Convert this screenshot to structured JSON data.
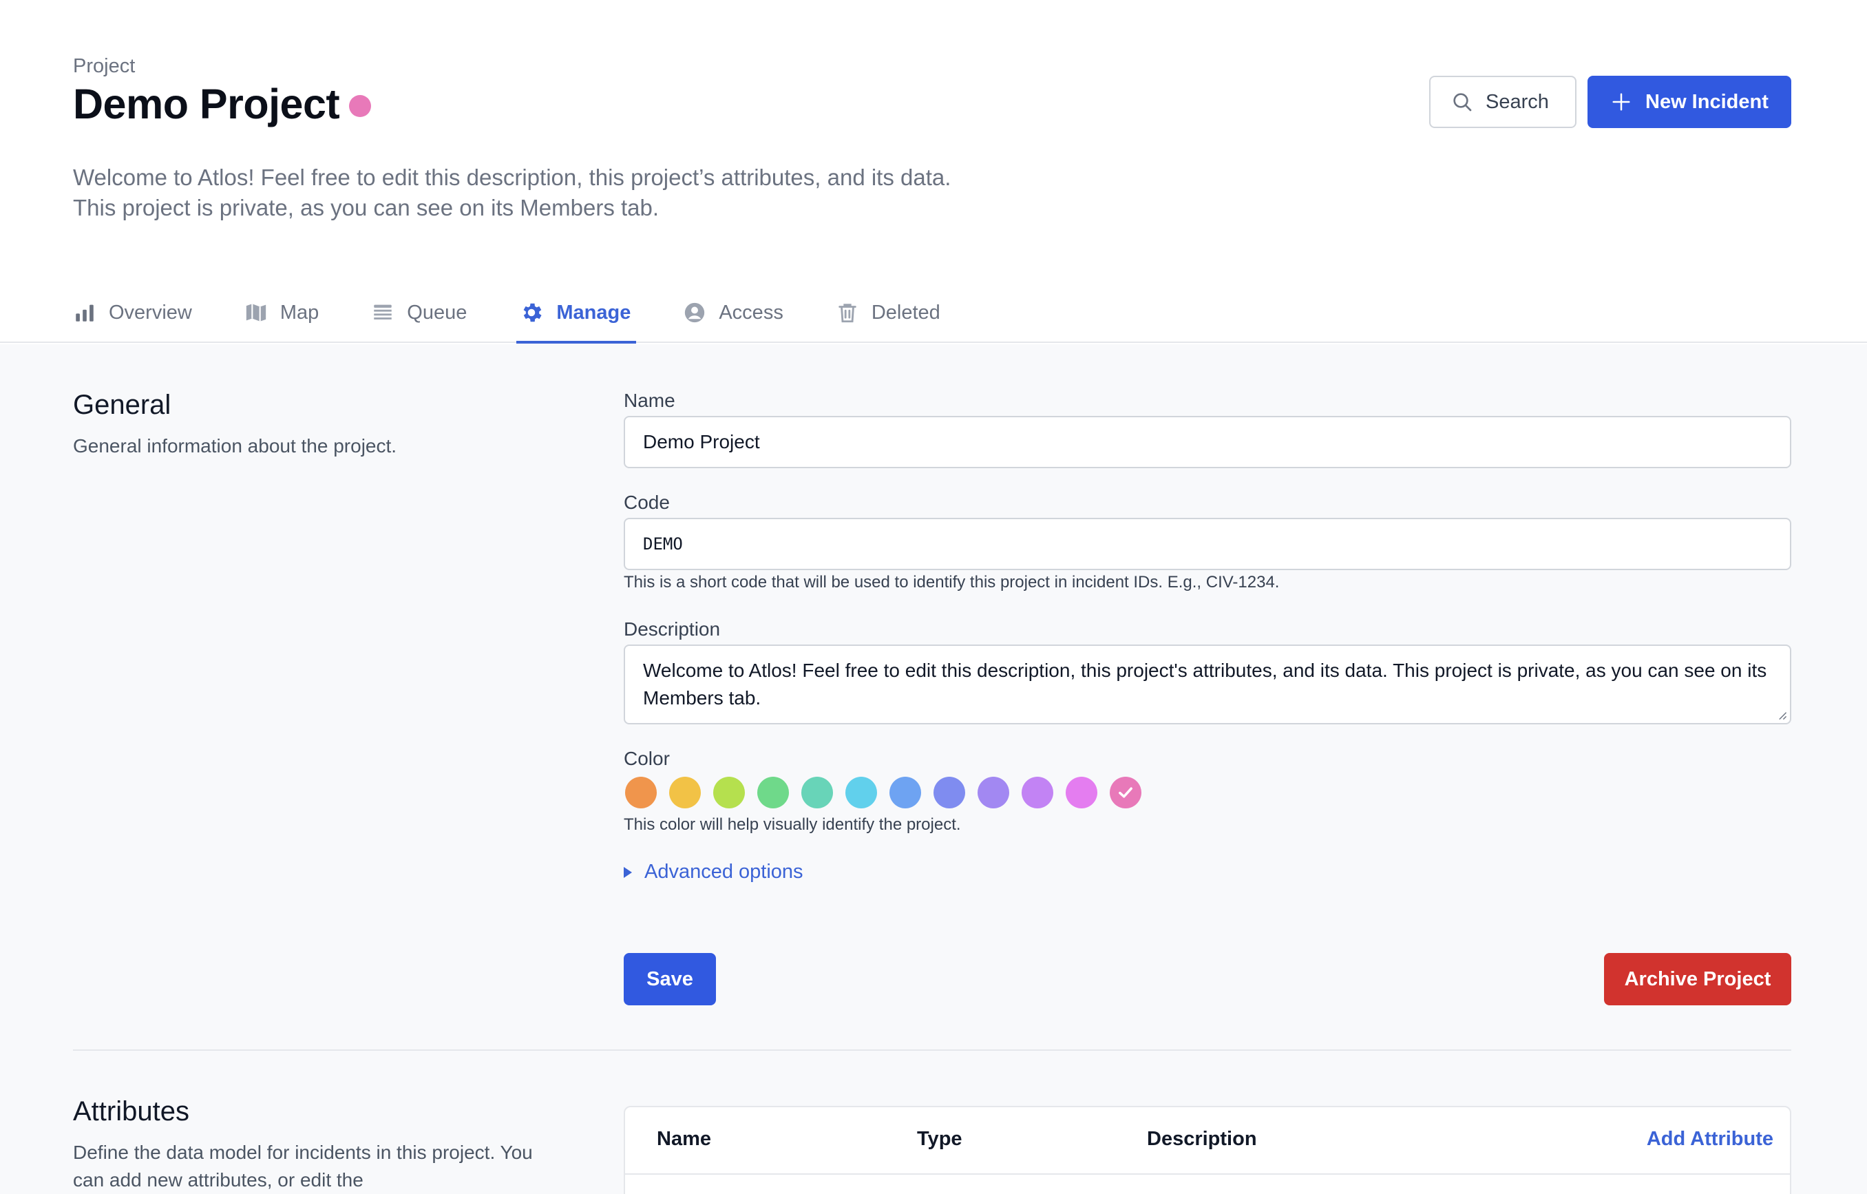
{
  "header": {
    "kicker": "Project",
    "title": "Demo Project",
    "project_color": "#e879b9",
    "description": "Welcome to Atlos! Feel free to edit this description, this project’s attributes, and its data. This project is private, as you can see on its Members tab.",
    "search_label": "Search",
    "new_incident_label": "New Incident"
  },
  "tabs": [
    {
      "label": "Overview",
      "icon": "bar-chart-icon"
    },
    {
      "label": "Map",
      "icon": "map-icon"
    },
    {
      "label": "Queue",
      "icon": "queue-icon"
    },
    {
      "label": "Manage",
      "icon": "gear-icon",
      "active": true
    },
    {
      "label": "Access",
      "icon": "user-circle-icon"
    },
    {
      "label": "Deleted",
      "icon": "trash-icon"
    }
  ],
  "general": {
    "title": "General",
    "description": "General information about the project.",
    "name_label": "Name",
    "name_value": "Demo Project",
    "code_label": "Code",
    "code_value": "DEMO",
    "code_help": "This is a short code that will be used to identify this project in incident IDs. E.g., CIV-1234.",
    "description_label": "Description",
    "description_value": "Welcome to Atlos! Feel free to edit this description, this project's attributes, and its data. This project is private, as you can see on its Members tab.",
    "color_label": "Color",
    "colors": [
      "#f0954c",
      "#f2c246",
      "#b5e04e",
      "#6fd98a",
      "#68d4b8",
      "#61d0ec",
      "#6ea3f2",
      "#7f8cf0",
      "#a288f2",
      "#c283f4",
      "#e47df0",
      "#e879b9"
    ],
    "selected_color_index": 11,
    "color_help": "This color will help visually identify the project.",
    "advanced_label": "Advanced options",
    "save_label": "Save",
    "archive_label": "Archive Project"
  },
  "attributes": {
    "title": "Attributes",
    "description": "Define the data model for incidents in this project. You can add new attributes, or edit the",
    "columns": [
      "Name",
      "Type",
      "Description"
    ],
    "add_label": "Add Attribute"
  }
}
